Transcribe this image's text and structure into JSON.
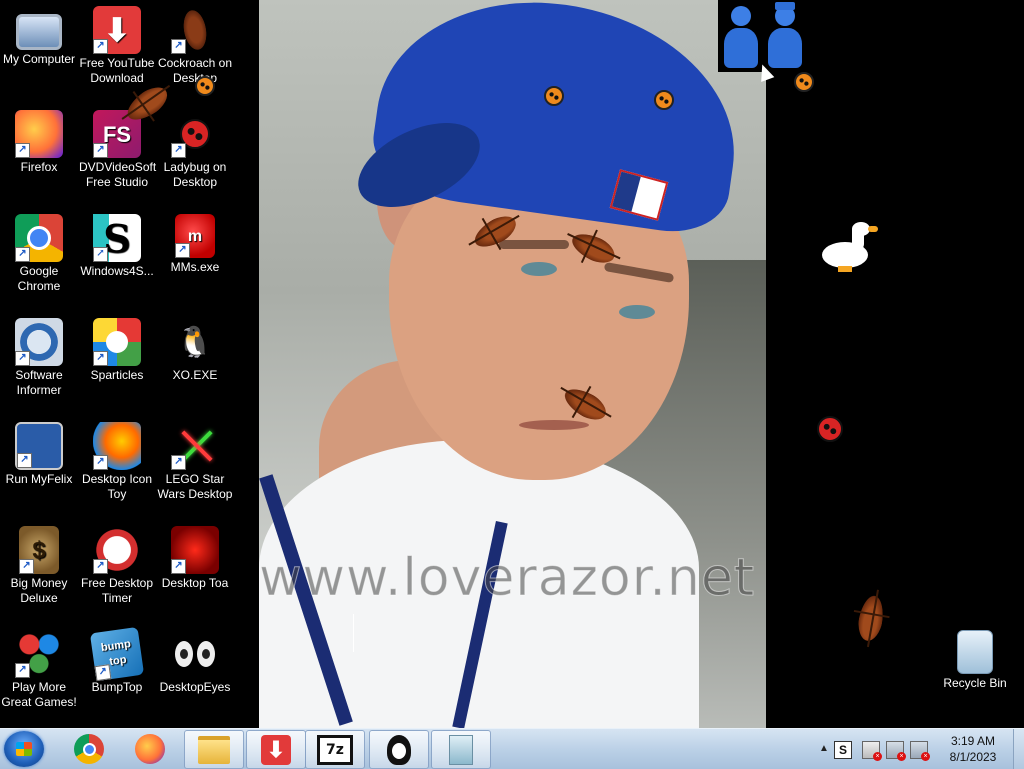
{
  "desktop_icons": [
    {
      "name": "my-computer",
      "label": "My Computer"
    },
    {
      "name": "free-youtube-download",
      "label": "Free YouTube Download"
    },
    {
      "name": "cockroach-on-desktop",
      "label": "Cockroach on Desktop"
    },
    {
      "name": "firefox",
      "label": "Firefox"
    },
    {
      "name": "dvdvideosoft-free-studio",
      "label": "DVDVideoSoft Free Studio",
      "glyph": "FS"
    },
    {
      "name": "ladybug-on-desktop",
      "label": "Ladybug on Desktop"
    },
    {
      "name": "google-chrome",
      "label": "Google Chrome"
    },
    {
      "name": "windows4s",
      "label": "Windows4S...",
      "glyph": "S"
    },
    {
      "name": "mms-exe",
      "label": "MMs.exe",
      "glyph": "m"
    },
    {
      "name": "software-informer",
      "label": "Software Informer"
    },
    {
      "name": "sparticles",
      "label": "Sparticles"
    },
    {
      "name": "xo-exe",
      "label": "XO.EXE"
    },
    {
      "name": "run-myfelix",
      "label": "Run MyFelix"
    },
    {
      "name": "desktop-icon-toy",
      "label": "Desktop Icon Toy"
    },
    {
      "name": "lego-star-wars-desktop",
      "label": "LEGO Star Wars Desktop"
    },
    {
      "name": "big-money-deluxe",
      "label": "Big Money Deluxe",
      "glyph": "$"
    },
    {
      "name": "free-desktop-timer",
      "label": "Free Desktop Timer"
    },
    {
      "name": "desktop-toa",
      "label": "Desktop Toa"
    },
    {
      "name": "play-more-great-games",
      "label": "Play More Great Games!"
    },
    {
      "name": "bumptop",
      "label": "BumpTop",
      "glyph": "bump top"
    },
    {
      "name": "desktopeyes",
      "label": "DesktopEyes"
    },
    {
      "name": "recycle-bin",
      "label": "Recycle Bin"
    }
  ],
  "wallpaper": {
    "watermark": "www.loverazor.net"
  },
  "taskbar": {
    "items": [
      {
        "name": "chrome",
        "icon": "chrome-icon"
      },
      {
        "name": "firefox",
        "icon": "firefox-icon"
      },
      {
        "name": "windows-explorer",
        "icon": "folder-icon"
      },
      {
        "name": "free-youtube-download",
        "icon": "download-arrow-icon"
      },
      {
        "name": "7-zip",
        "icon": "7zip-icon",
        "glyph": "7z"
      },
      {
        "name": "xo-exe",
        "icon": "penguin-icon"
      },
      {
        "name": "document",
        "icon": "document-icon"
      }
    ],
    "tray": {
      "show_hidden_glyph": "▲",
      "s_glyph": "S",
      "time": "3:19 AM",
      "date": "8/1/2023"
    }
  },
  "colors": {
    "taskbar_bg": "#bcd1e7",
    "desktop_bg": "#000000",
    "cap_blue": "#1f45b5"
  }
}
